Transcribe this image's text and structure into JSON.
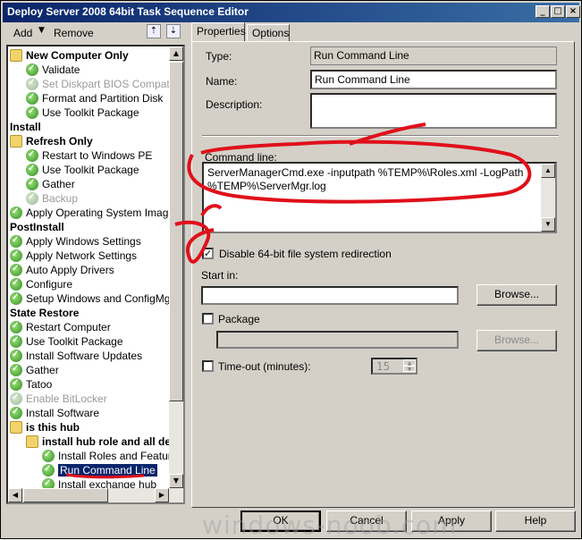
{
  "window": {
    "title": "Deploy Server 2008 64bit Task Sequence Editor"
  },
  "toolbar": {
    "add_label": "Add",
    "remove_label": "Remove"
  },
  "tree": [
    {
      "label": "New Computer Only",
      "kind": "group-folder",
      "indent": 0
    },
    {
      "label": "Validate",
      "kind": "step",
      "indent": 1
    },
    {
      "label": "Set Diskpart BIOS Compatibi",
      "kind": "step-disabled",
      "indent": 1
    },
    {
      "label": "Format and Partition Disk",
      "kind": "step",
      "indent": 1
    },
    {
      "label": "Use Toolkit Package",
      "kind": "step",
      "indent": 1
    },
    {
      "label": "Install",
      "kind": "group",
      "indent": 0
    },
    {
      "label": "Refresh Only",
      "kind": "group-folder",
      "indent": 0
    },
    {
      "label": "Restart to Windows PE",
      "kind": "step",
      "indent": 1
    },
    {
      "label": "Use Toolkit Package",
      "kind": "step",
      "indent": 1
    },
    {
      "label": "Gather",
      "kind": "step",
      "indent": 1
    },
    {
      "label": "Backup",
      "kind": "step-disabled",
      "indent": 1
    },
    {
      "label": "Apply Operating System Image",
      "kind": "step",
      "indent": 0
    },
    {
      "label": "PostInstall",
      "kind": "group",
      "indent": 0
    },
    {
      "label": "Apply Windows Settings",
      "kind": "step",
      "indent": 0
    },
    {
      "label": "Apply Network Settings",
      "kind": "step",
      "indent": 0
    },
    {
      "label": "Auto Apply Drivers",
      "kind": "step",
      "indent": 0
    },
    {
      "label": "Configure",
      "kind": "step",
      "indent": 0
    },
    {
      "label": "Setup Windows and ConfigMgr",
      "kind": "step",
      "indent": 0
    },
    {
      "label": "State Restore",
      "kind": "group",
      "indent": 0
    },
    {
      "label": "Restart Computer",
      "kind": "step",
      "indent": 0
    },
    {
      "label": "Use Toolkit Package",
      "kind": "step",
      "indent": 0
    },
    {
      "label": "Install Software Updates",
      "kind": "step",
      "indent": 0
    },
    {
      "label": "Gather",
      "kind": "step",
      "indent": 0
    },
    {
      "label": "Tatoo",
      "kind": "step",
      "indent": 0
    },
    {
      "label": "Enable BitLocker",
      "kind": "step-disabled",
      "indent": 0
    },
    {
      "label": "Install Software",
      "kind": "step",
      "indent": 0
    },
    {
      "label": "is this hub",
      "kind": "group-folder",
      "indent": 0
    },
    {
      "label": "install hub role and all de",
      "kind": "group-folder",
      "indent": 1
    },
    {
      "label": "Install Roles and Feature",
      "kind": "step",
      "indent": 2
    },
    {
      "label": "Run Command Line",
      "kind": "step-selected",
      "indent": 2
    },
    {
      "label": "Install exchange hub",
      "kind": "step",
      "indent": 2
    }
  ],
  "tabs": {
    "properties": "Properties",
    "options": "Options"
  },
  "properties": {
    "type_label": "Type:",
    "type_value": "Run Command Line",
    "name_label": "Name:",
    "name_value": "Run Command Line",
    "description_label": "Description:",
    "description_value": "",
    "command_line_label": "Command line:",
    "command_line_value": "ServerManagerCmd.exe -inputpath %TEMP%\\Roles.xml -LogPath %TEMP%\\ServerMgr.log",
    "disable_redirection_label": "Disable 64-bit file system redirection",
    "disable_redirection_checked": true,
    "start_in_label": "Start in:",
    "start_in_value": "",
    "browse_label": "Browse...",
    "package_label": "Package",
    "package_checked": false,
    "package_value": "",
    "package_browse_label": "Browse...",
    "timeout_label": "Time-out (minutes):",
    "timeout_checked": false,
    "timeout_value": "15"
  },
  "buttons": {
    "ok": "OK",
    "cancel": "Cancel",
    "apply": "Apply",
    "help": "Help"
  },
  "watermark": "windows-noob.com",
  "annotation_color": "#e0101a"
}
